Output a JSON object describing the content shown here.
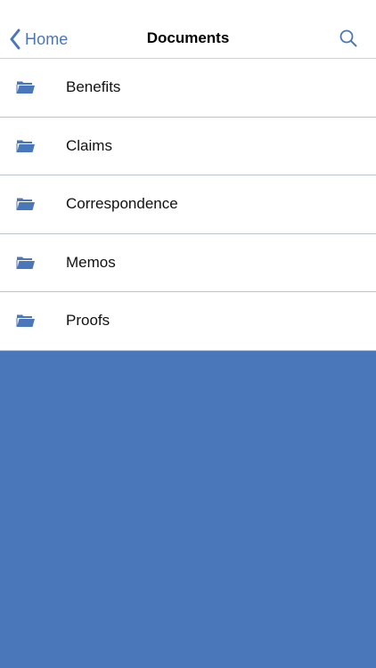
{
  "nav": {
    "back_label": "Home",
    "title": "Documents"
  },
  "icons": {
    "back": "chevron-left-icon",
    "search": "search-icon",
    "folder": "folder-icon"
  },
  "colors": {
    "accent": "#4a76ba",
    "background": "#4a76ba"
  },
  "folders": [
    {
      "label": "Benefits"
    },
    {
      "label": "Claims"
    },
    {
      "label": "Correspondence"
    },
    {
      "label": "Memos"
    },
    {
      "label": "Proofs"
    }
  ]
}
